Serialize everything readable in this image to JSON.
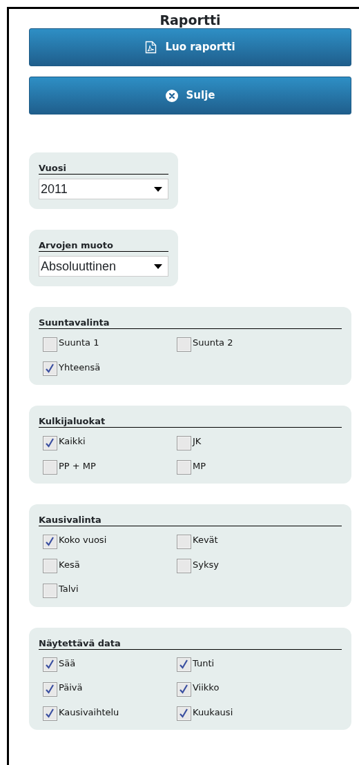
{
  "title": "Raportti",
  "buttons": [
    {
      "kind": "pdf",
      "label": "Luo raportti"
    },
    {
      "kind": "close",
      "label": "Sulje"
    }
  ],
  "selects": [
    {
      "label": "Vuosi",
      "value": "2011"
    },
    {
      "label": "Arvojen muoto",
      "value": "Absoluuttinen"
    }
  ],
  "groups": [
    {
      "title": "Suuntavalinta",
      "options": [
        {
          "label": "Suunta 1",
          "checked": false
        },
        {
          "label": "Suunta 2",
          "checked": false
        },
        {
          "label": "Yhteensä",
          "checked": true
        }
      ]
    },
    {
      "title": "Kulkijaluokat",
      "options": [
        {
          "label": "Kaikki",
          "checked": true
        },
        {
          "label": "JK",
          "checked": false
        },
        {
          "label": "PP + MP",
          "checked": false
        },
        {
          "label": "MP",
          "checked": false
        }
      ]
    },
    {
      "title": "Kausivalinta",
      "options": [
        {
          "label": "Koko vuosi",
          "checked": true
        },
        {
          "label": "Kevät",
          "checked": false
        },
        {
          "label": "Kesä",
          "checked": false
        },
        {
          "label": "Syksy",
          "checked": false
        },
        {
          "label": "Talvi",
          "checked": false
        }
      ]
    },
    {
      "title": "Näytettävä data",
      "options": [
        {
          "label": "Sää",
          "checked": true
        },
        {
          "label": "Tunti",
          "checked": true
        },
        {
          "label": "Päivä",
          "checked": true
        },
        {
          "label": "Viikko",
          "checked": true
        },
        {
          "label": "Kausivaihtelu",
          "checked": true
        },
        {
          "label": "Kuukausi",
          "checked": true
        }
      ]
    }
  ]
}
